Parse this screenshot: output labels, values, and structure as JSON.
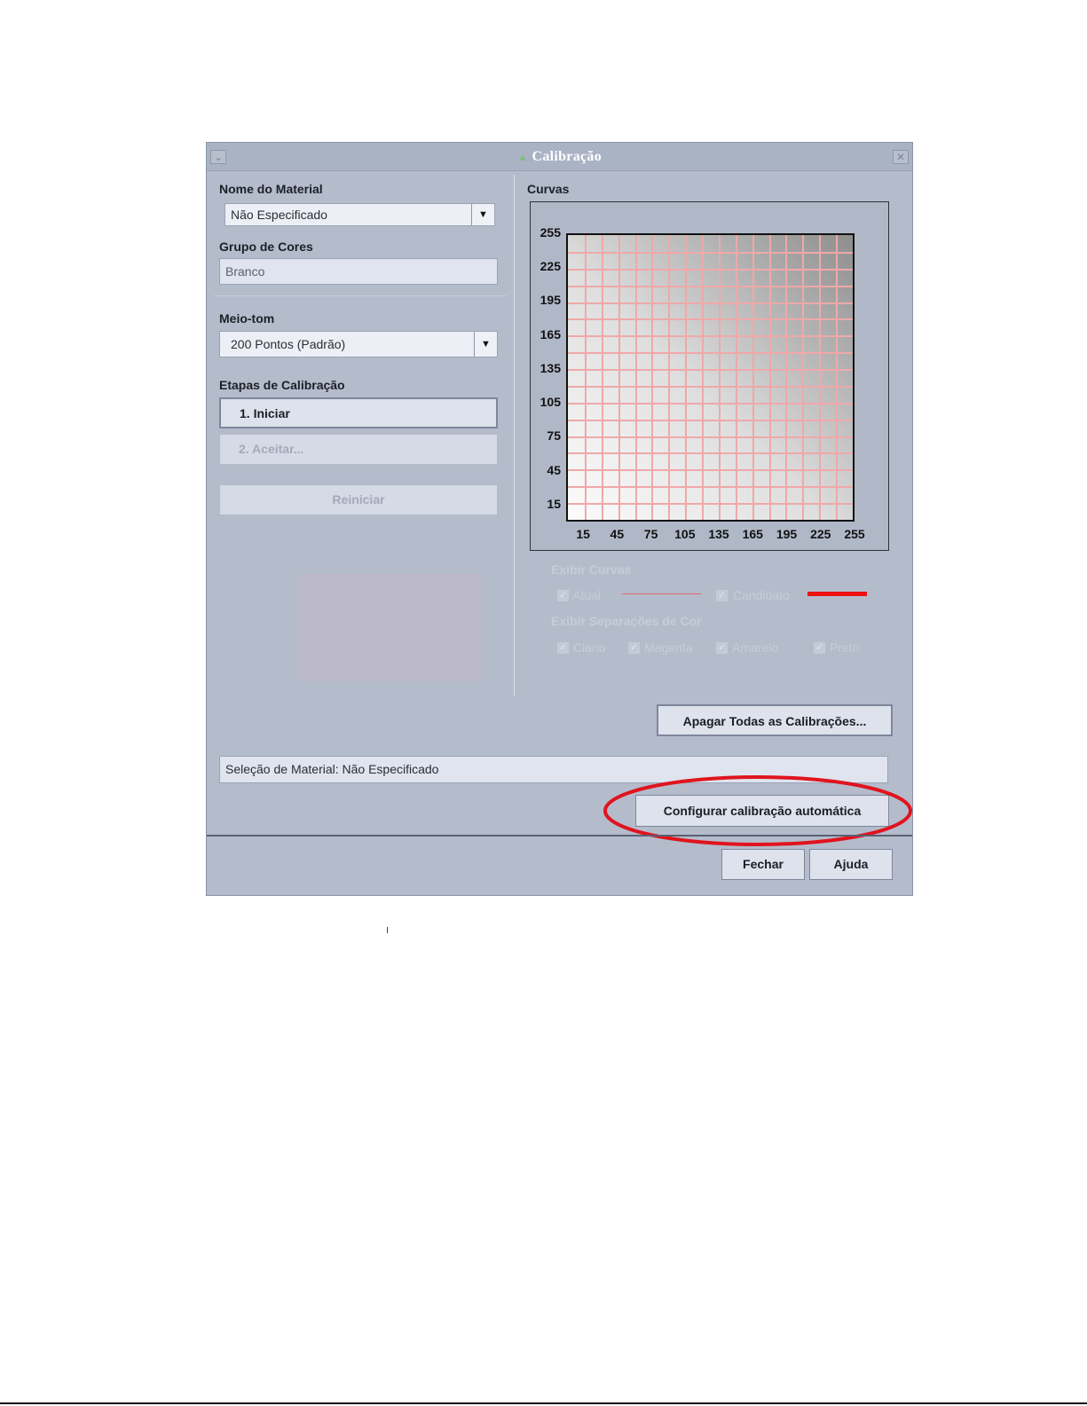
{
  "window": {
    "title": "Calibração"
  },
  "left": {
    "material_label": "Nome do Material",
    "material_value": "Não Especificado",
    "color_group_label": "Grupo de Cores",
    "color_group_value": "Branco",
    "halftone_label": "Meio-tom",
    "halftone_value": "200 Pontos (Padrão)",
    "steps_label": "Etapas de Calibração",
    "step1": "1. Iniciar",
    "step2": "2.  Aceitar...",
    "restart": "Reiniciar"
  },
  "curves": {
    "label": "Curvas",
    "y_ticks": [
      "255",
      "225",
      "195",
      "165",
      "135",
      "105",
      "75",
      "45",
      "15"
    ],
    "x_ticks": [
      "15",
      "45",
      "75",
      "105",
      "135",
      "165",
      "195",
      "225",
      "255"
    ],
    "show_curves_label": "Exibir Curvas",
    "current": "Atual",
    "candidate": "Candidato",
    "show_separations_label": "Exibir Separações de Cor",
    "separations": [
      "Ciano",
      "Magenta",
      "Amarelo",
      "Preto"
    ],
    "current_color": "#e06a6a",
    "candidate_color": "#ee1111"
  },
  "buttons": {
    "clear_all": "Apagar Todas as Calibrações...",
    "auto_config": "Configurar calibração automática",
    "close": "Fechar",
    "help": "Ajuda"
  },
  "status": {
    "material_selection": "Seleção de Material: Não Especificado"
  },
  "highlight": {
    "color": "#e0141e"
  }
}
